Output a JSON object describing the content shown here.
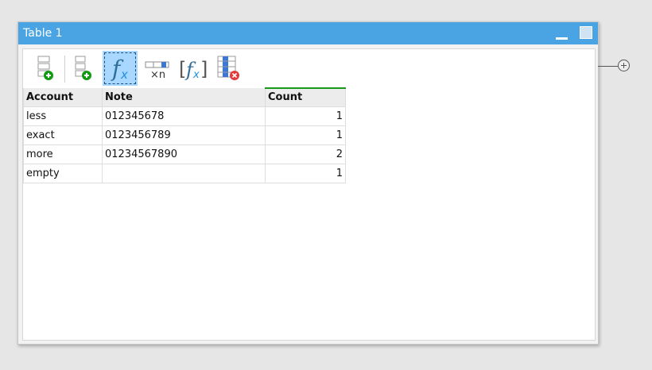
{
  "window": {
    "title": "Table 1"
  },
  "toolbar": {
    "icons": [
      "add-row-icon",
      "add-column-icon",
      "formula-icon",
      "repeat-rows-icon",
      "formula-bracket-icon",
      "delete-column-icon"
    ],
    "active": "formula-icon"
  },
  "table": {
    "columns": [
      "Account",
      "Note",
      "Count"
    ],
    "rows": [
      {
        "account": "less",
        "note": "012345678",
        "count": "1"
      },
      {
        "account": "exact",
        "note": "0123456789",
        "count": "1"
      },
      {
        "account": "more",
        "note": "01234567890",
        "count": "2"
      },
      {
        "account": "empty",
        "note": "",
        "count": "1"
      }
    ]
  },
  "colors": {
    "titlebar": "#4aa3e2",
    "active_tool": "#a8d8ff",
    "count_header_accent": "#1a9a1a"
  }
}
